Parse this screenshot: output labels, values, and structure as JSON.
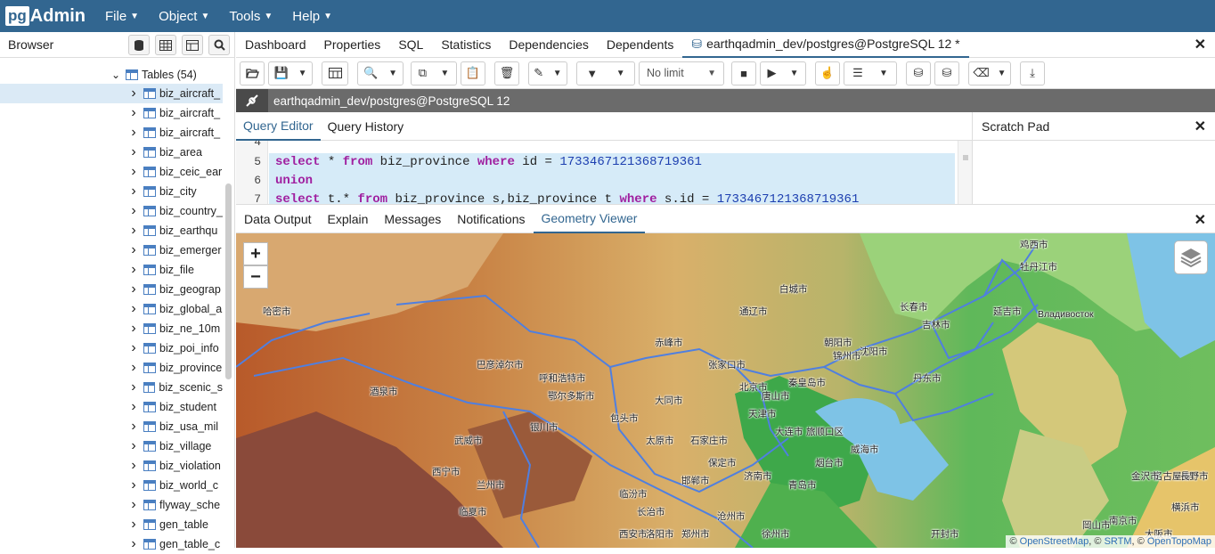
{
  "app": {
    "logo_pg": "pg",
    "logo_admin": "Admin"
  },
  "menu": [
    {
      "label": "File"
    },
    {
      "label": "Object"
    },
    {
      "label": "Tools"
    },
    {
      "label": "Help"
    }
  ],
  "browser": {
    "title": "Browser",
    "tables_node": "Tables (54)",
    "items": [
      "biz_aircraft_",
      "biz_aircraft_",
      "biz_aircraft_",
      "biz_area",
      "biz_ceic_ear",
      "biz_city",
      "biz_country_",
      "biz_earthqu",
      "biz_emerger",
      "biz_file",
      "biz_geograp",
      "biz_global_a",
      "biz_ne_10m",
      "biz_poi_info",
      "biz_province",
      "biz_scenic_s",
      "biz_student",
      "biz_usa_mil",
      "biz_village",
      "biz_violation",
      "biz_world_c",
      "flyway_sche",
      "gen_table",
      "gen_table_c"
    ]
  },
  "tabs": [
    "Dashboard",
    "Properties",
    "SQL",
    "Statistics",
    "Dependencies",
    "Dependents"
  ],
  "active_tab": "earthqadmin_dev/postgres@PostgreSQL 12 *",
  "toolbar": {
    "limit": "No limit"
  },
  "connection": "earthqadmin_dev/postgres@PostgreSQL 12",
  "query_tabs": [
    "Query Editor",
    "Query History"
  ],
  "scratch_title": "Scratch Pad",
  "code": {
    "lines": [
      {
        "n": "4"
      },
      {
        "n": "5",
        "kw1": "select",
        "t1": " * ",
        "kw2": "from",
        "t2": " biz_province ",
        "kw3": "where",
        "t3": " id = ",
        "num": "1733467121368719361"
      },
      {
        "n": "6",
        "kw1": "union"
      },
      {
        "n": "7",
        "kw1": "select",
        "t1": " t.* ",
        "kw2": "from",
        "t2": " biz_province s,biz_province t ",
        "kw3": "where",
        "t3": " s.id = ",
        "num": "1733467121368719361"
      }
    ]
  },
  "output_tabs": [
    "Data Output",
    "Explain",
    "Messages",
    "Notifications",
    "Geometry Viewer"
  ],
  "map": {
    "zoom_in": "+",
    "zoom_out": "−",
    "labels": [
      "北京市",
      "天津市",
      "唐山市",
      "大连市",
      "沈阳市",
      "长春市",
      "吉林市",
      "哈密市",
      "巴彦淖尔市",
      "呼和浩特市",
      "鄂尔多斯市",
      "太原市",
      "石家庄市",
      "济南市",
      "青岛市",
      "西宁市",
      "兰州市",
      "银川市",
      "武威市",
      "酒泉市",
      "郑州市",
      "徐州市",
      "延吉市",
      "Владивосток",
      "牡丹江市",
      "鸡西市",
      "赤峰市",
      "张家口市",
      "大同市",
      "包头市",
      "临夏市",
      "西安市",
      "威海市",
      "烟台市",
      "旅顺口区",
      "锦州市",
      "朝阳市",
      "丹东市",
      "通辽市",
      "白城市",
      "秦皇岛市",
      "保定市",
      "沧州市",
      "邯郸市",
      "临汾市",
      "长治市",
      "洛阳市",
      "开封市",
      "南京市",
      "大阪市",
      "名古屋市",
      "横浜市",
      "金沢市",
      "長野市",
      "岡山市"
    ],
    "attribution": {
      "prefix": "© ",
      "osm": "OpenStreetMap",
      "sep1": ", © ",
      "srtm": "SRTM",
      "sep2": ", © ",
      "otm": "OpenTopoMap"
    }
  }
}
